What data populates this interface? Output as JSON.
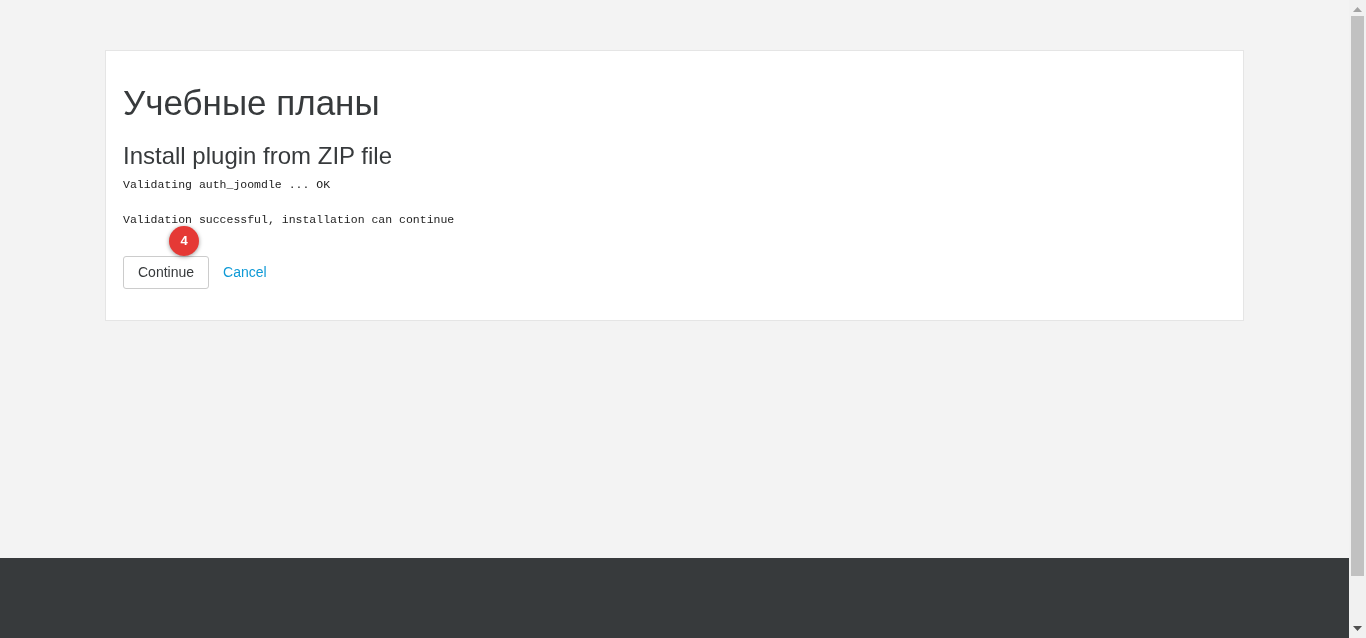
{
  "page_title": "Учебные планы",
  "section_title": "Install plugin from ZIP file",
  "messages": [
    "Validating auth_joomdle ... OK",
    "Validation successful, installation can continue"
  ],
  "buttons": [
    {
      "label": "Continue",
      "kind": "button"
    },
    {
      "label": "Cancel",
      "kind": "link"
    }
  ],
  "step_badge": "4"
}
